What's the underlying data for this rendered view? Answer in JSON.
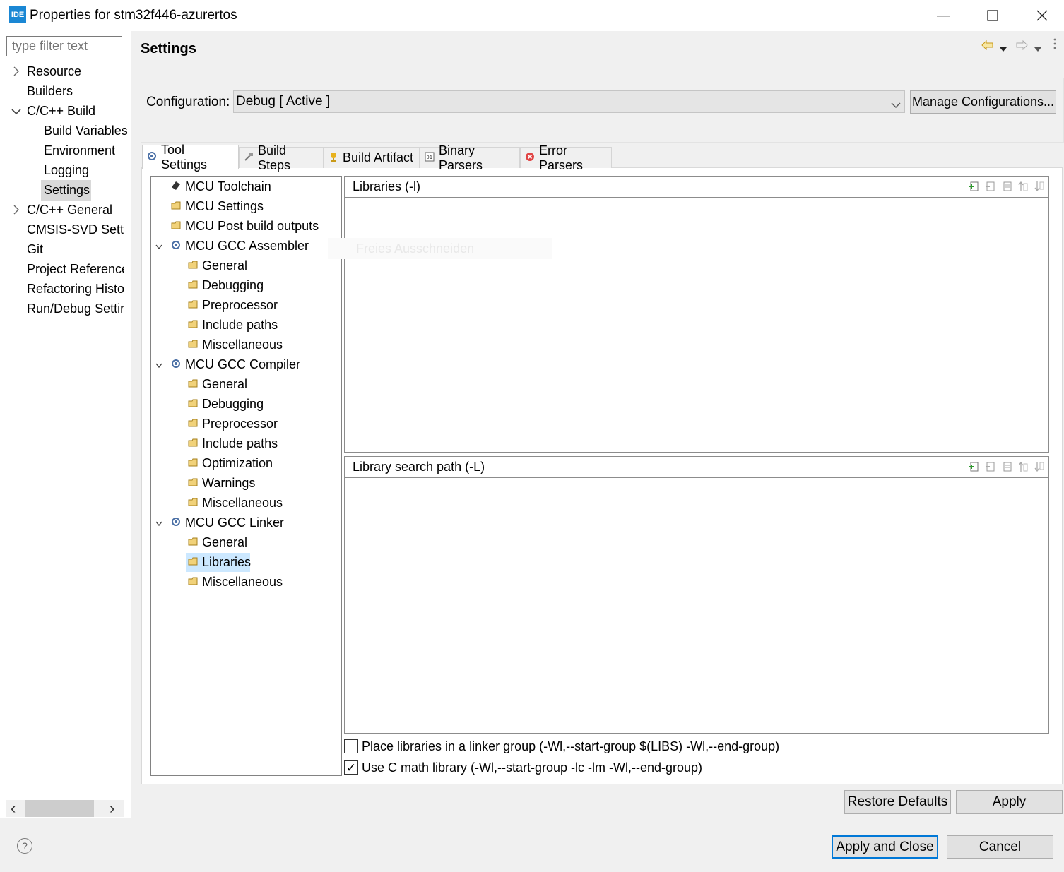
{
  "window": {
    "app_icon_text": "IDE",
    "title": "Properties for stm32f446-azurertos",
    "minimize_glyph": "—",
    "maximize_glyph": "☐",
    "close_glyph": "✕"
  },
  "left_pane": {
    "filter_placeholder": "type filter text",
    "items": [
      {
        "label": "Resource"
      },
      {
        "label": "Builders"
      },
      {
        "label": "C/C++ Build"
      },
      {
        "label": "Build Variables"
      },
      {
        "label": "Environment"
      },
      {
        "label": "Logging"
      },
      {
        "label": "Settings"
      },
      {
        "label": "C/C++ General"
      },
      {
        "label": "CMSIS-SVD Settir"
      },
      {
        "label": "Git"
      },
      {
        "label": "Project Reference:"
      },
      {
        "label": "Refactoring Histo"
      },
      {
        "label": "Run/Debug Settir"
      }
    ],
    "scroll_left": "‹",
    "scroll_right": "›"
  },
  "header": {
    "title": "Settings"
  },
  "configuration": {
    "label": "Configuration:",
    "value": "Debug  [ Active ]",
    "manage_button": "Manage Configurations..."
  },
  "tabs": [
    {
      "label": "Tool Settings",
      "icon": "tool-settings-icon"
    },
    {
      "label": "Build Steps",
      "icon": "build-steps-icon"
    },
    {
      "label": "Build Artifact",
      "icon": "trophy-icon"
    },
    {
      "label": "Binary Parsers",
      "icon": "binary-icon"
    },
    {
      "label": "Error Parsers",
      "icon": "error-icon"
    }
  ],
  "tool_tree": [
    {
      "label": "MCU Toolchain"
    },
    {
      "label": "MCU Settings"
    },
    {
      "label": "MCU Post build outputs"
    },
    {
      "label": "MCU GCC Assembler"
    },
    {
      "label": "General"
    },
    {
      "label": "Debugging"
    },
    {
      "label": "Preprocessor"
    },
    {
      "label": "Include paths"
    },
    {
      "label": "Miscellaneous"
    },
    {
      "label": "MCU GCC Compiler"
    },
    {
      "label": "General"
    },
    {
      "label": "Debugging"
    },
    {
      "label": "Preprocessor"
    },
    {
      "label": "Include paths"
    },
    {
      "label": "Optimization"
    },
    {
      "label": "Warnings"
    },
    {
      "label": "Miscellaneous"
    },
    {
      "label": "MCU GCC Linker"
    },
    {
      "label": "General"
    },
    {
      "label": "Libraries"
    },
    {
      "label": "Miscellaneous"
    }
  ],
  "libraries": {
    "title": "Libraries (-l)",
    "items": []
  },
  "library_search_path": {
    "title": "Library search path (-L)",
    "items": []
  },
  "ghost_text": "Freies Ausschneiden",
  "options": {
    "linker_group": {
      "label": "Place libraries in a linker group (-Wl,--start-group $(LIBS) -Wl,--end-group)",
      "checked": false
    },
    "c_math": {
      "label": "Use C math library (-Wl,--start-group -lc -lm -Wl,--end-group)",
      "checked": true,
      "check_glyph": "✓"
    }
  },
  "buttons": {
    "restore_defaults": "Restore Defaults",
    "apply": "Apply",
    "apply_and_close": "Apply and Close",
    "cancel": "Cancel",
    "help": "?"
  },
  "colors": {
    "selection": "#cce8ff",
    "accent_border": "#0078d7"
  }
}
